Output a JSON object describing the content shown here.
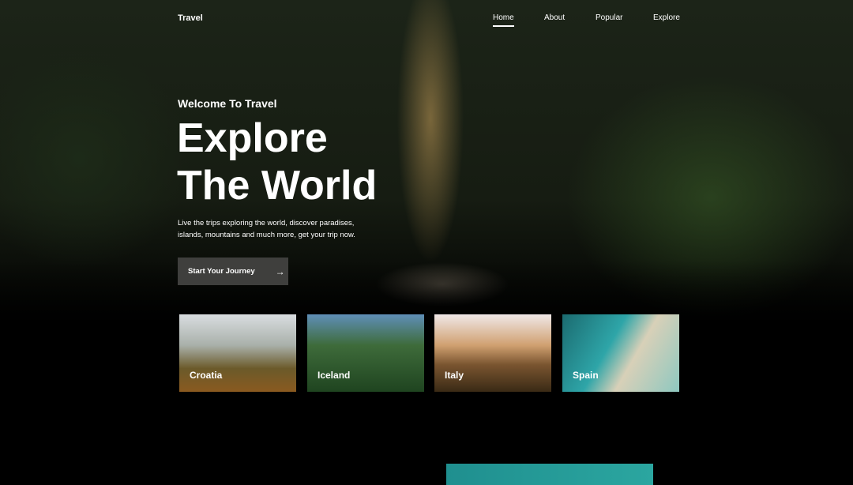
{
  "header": {
    "logo": "Travel",
    "nav": [
      "Home",
      "About",
      "Popular",
      "Explore"
    ],
    "active": "Home"
  },
  "hero": {
    "subtitle": "Welcome To Travel",
    "title_line1": "Explore",
    "title_line2": "The World",
    "description_line1": "Live the trips exploring the world, discover paradises,",
    "description_line2": "islands, mountains and much more, get your trip now.",
    "button_label": "Start Your Journey",
    "button_icon": "arrow-right-icon"
  },
  "destinations": [
    "Croatia",
    "Iceland",
    "Italy",
    "Spain"
  ]
}
